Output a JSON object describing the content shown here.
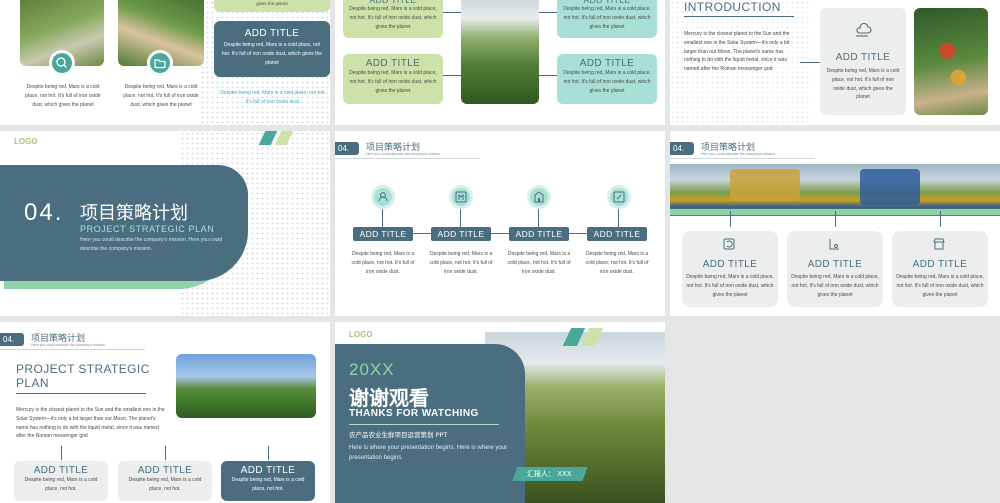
{
  "texts": {
    "body_short": "Despite being red, Mars is a cold place, not hot. It's full of iron oxide dust, which gives the planet",
    "body_dust": "Despite being red, Mars is a cold place, not hot. It's full of iron oxide dust.",
    "body_hot": "Despite being red, Mars is a cold place, not hot.",
    "body_gives": "Despite being red, Mars is a cold place, not hot. It's full of iron oxide dust, which gives the planet",
    "body_full_of": "Despite being red, Mars is a cold place, not hot. It's full of iron oxide dust.",
    "add_title": "ADD TITLE",
    "subtitle_en": "Here you could describe the company's mission.",
    "subtitle_en2": "Here you could describe the company's mission. Here you could describe the company's mission.",
    "sun_text": "Mercury is the closest planet to the Sun and the smallest one in the Solar System—it's only a bit larger than our Moon. The planet's name has nothing to do with the liquid metal, since it was named after the Roman messenger god",
    "logo": "LOGO",
    "section_num": "04.",
    "section_cn": "项目策略计划",
    "section_en": "PROJECT STRATEGIC PLAN",
    "intro": "INTRODUCTION",
    "project_title": "PROJECT STRATEGIC PLAN",
    "year": "20XX",
    "thanks_cn": "谢谢观看",
    "thanks_en": "THANKS FOR WATCHING",
    "ppt_cn": "农产品农业生鲜项目运营策划 PPT",
    "presentation_en": "Here is where your presentation begins. Here is where your presentation begins.",
    "reporter": "汇报人：  XXX"
  },
  "colors": {
    "teal": "#4a6e80",
    "green_light": "#cde2a8",
    "mint": "#a8e0d6",
    "green_accent": "#8fd3a8",
    "card_gray": "#eceeee"
  },
  "icons": [
    "search-icon",
    "folder-icon",
    "cloud-sun-icon",
    "user-target-icon",
    "image-frame-icon",
    "building-icon",
    "edit-icon",
    "refresh-icon",
    "chart-icon",
    "store-icon"
  ]
}
